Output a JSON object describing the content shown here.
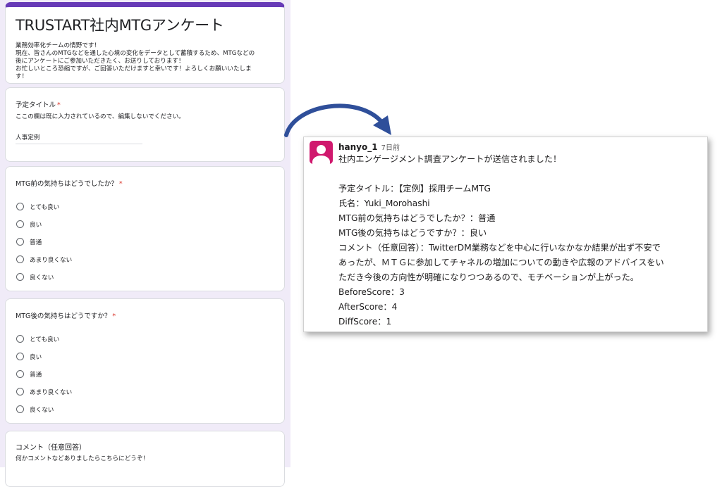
{
  "form": {
    "title": "TRUSTART社内MTGアンケート",
    "description": [
      "業務効率化チームの情野です！",
      "現在、皆さんのMTGなどを通した心境の変化をデータとして蓄積するため、MTGなどの",
      "後にアンケートにご参加いただきたく、お送りしております！",
      "お忙しいところ恐縮ですが、ご回答いただけますと幸いです！よろしくお願いいたしま",
      "す！"
    ],
    "required_mark": "*",
    "q1": {
      "label": "予定タイトル",
      "help": "ここの欄は既に入力されているので、編集しないでください。",
      "value": "人事定例"
    },
    "q2": {
      "label": "MTG前の気持ちはどうでしたか？",
      "options": [
        "とても良い",
        "良い",
        "普通",
        "あまり良くない",
        "良くない"
      ]
    },
    "q3": {
      "label": "MTG後の気持ちはどうですか？",
      "options": [
        "とても良い",
        "良い",
        "普通",
        "あまり良くない",
        "良くない"
      ]
    },
    "q4": {
      "label": "コメント（任意回答）",
      "help": "何かコメントなどありましたらこちらにどうぞ！"
    }
  },
  "message": {
    "username": "hanyo_1",
    "timestamp": "7日前",
    "lines": [
      "社内エンゲージメント調査アンケートが送信されました！",
      "",
      "予定タイトル：【定例】採用チームMTG",
      "氏名：Yuki_Morohashi",
      "MTG前の気持ちはどうでしたか？：普通",
      "MTG後の気持ちはどうですか？：良い",
      "コメント（任意回答）：TwitterDM業務などを中心に行いなかなか結果が出ず不安で",
      "あったが、ＭＴＧに参加してチャネルの増加についての動きや広報のアドバイスをい",
      "ただき今後の方向性が明確になりつつあるので、モチベーションが上がった。",
      "BeforeScore：3",
      "AfterScore：4",
      "DiffScore：1"
    ]
  },
  "colors": {
    "form_accent": "#673ab7",
    "form_background": "#f0ebf8",
    "required": "#d93025",
    "arrow": "#2f4f9a",
    "avatar": "#d0196e"
  },
  "icons": {
    "arrow": "curved-arrow-icon",
    "avatar": "user-avatar-icon",
    "radio": "radio-button-icon"
  }
}
